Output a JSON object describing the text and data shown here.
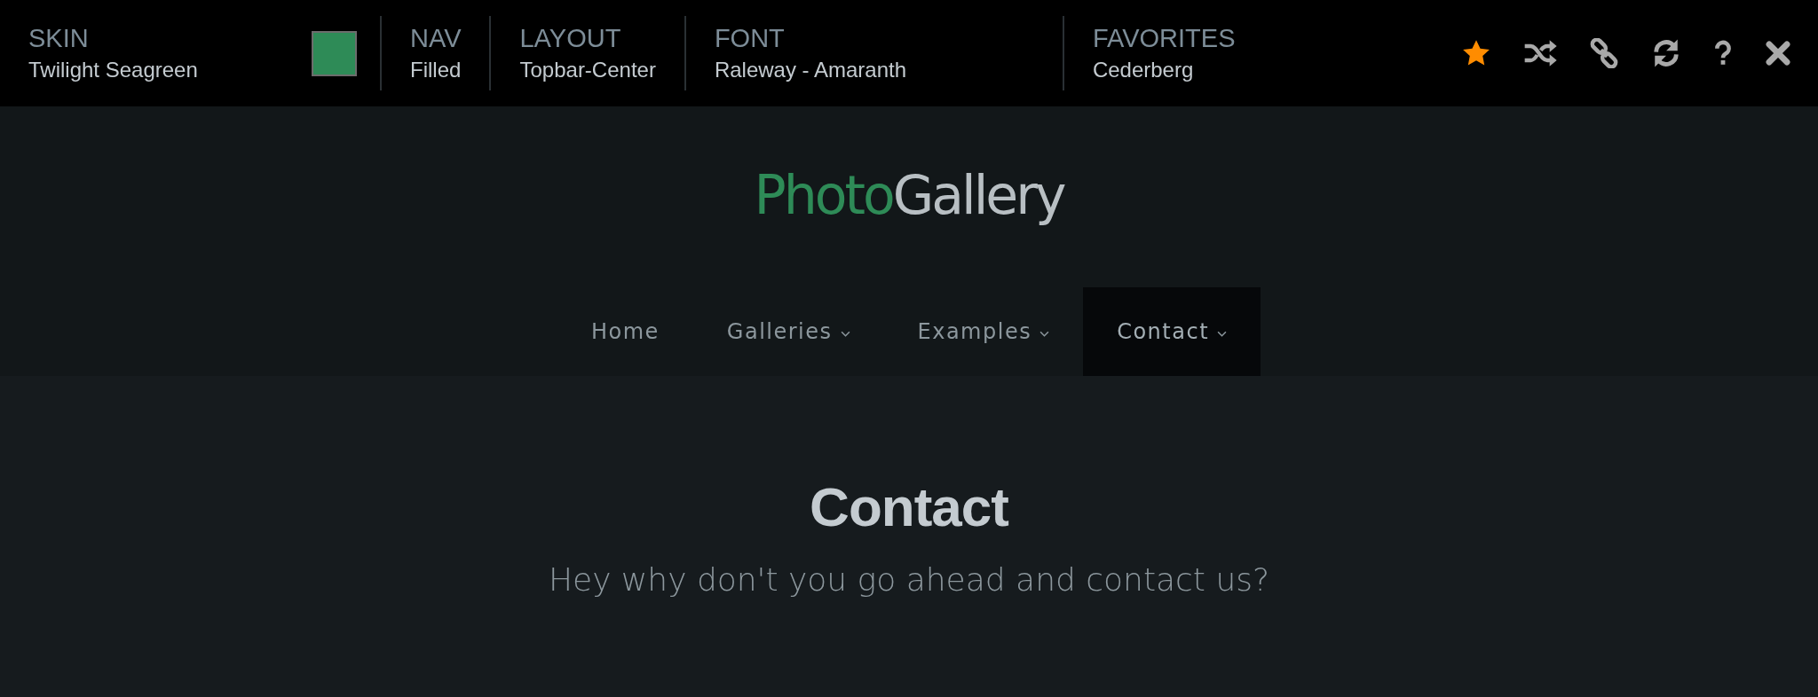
{
  "topbar": {
    "groups": [
      {
        "label": "SKIN",
        "value": "Twilight Seagreen",
        "color": "#2e8b57"
      },
      {
        "label": "NAV",
        "value": "Filled"
      },
      {
        "label": "LAYOUT",
        "value": "Topbar-Center"
      },
      {
        "label": "FONT",
        "value": "Raleway - Amaranth"
      },
      {
        "label": "FAVORITES",
        "value": "Cederberg"
      }
    ],
    "tools": [
      {
        "kind": "star",
        "on": true
      },
      {
        "kind": "shuffle"
      },
      {
        "kind": "link"
      },
      {
        "kind": "refresh"
      },
      {
        "kind": "help"
      },
      {
        "kind": "close"
      }
    ]
  },
  "logo": {
    "first": "Photo",
    "second": "Gallery"
  },
  "nav": [
    {
      "label": "Home",
      "dropdown": false,
      "selected": false
    },
    {
      "label": "Galleries",
      "dropdown": true,
      "selected": false
    },
    {
      "label": "Examples",
      "dropdown": true,
      "selected": false
    },
    {
      "label": "Contact",
      "dropdown": true,
      "selected": true
    }
  ],
  "page": {
    "title": "Contact",
    "subtitle": "Hey why don't you go ahead and contact us?"
  }
}
